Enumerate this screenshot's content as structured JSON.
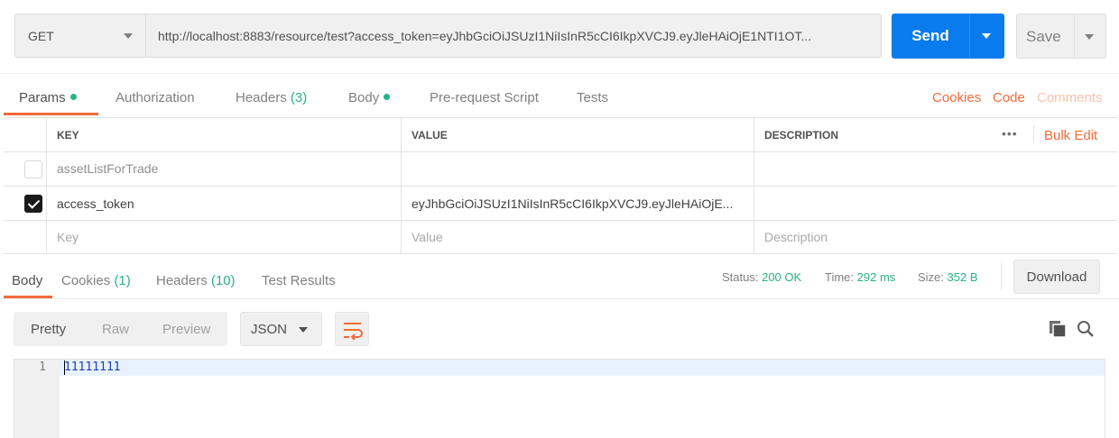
{
  "request": {
    "method": "GET",
    "url": "http://localhost:8883/resource/test?access_token=eyJhbGciOiJSUzI1NiIsInR5cCI6IkpXVCJ9.eyJleHAiOjE1NTI1OT...",
    "send_label": "Send",
    "save_label": "Save"
  },
  "request_tabs": {
    "params": "Params",
    "authorization": "Authorization",
    "headers": "Headers",
    "headers_count": "(3)",
    "body": "Body",
    "prerequest": "Pre-request Script",
    "tests": "Tests",
    "cookies_link": "Cookies",
    "code_link": "Code",
    "comments_link": "Comments"
  },
  "params_table": {
    "col_key": "KEY",
    "col_value": "VALUE",
    "col_description": "DESCRIPTION",
    "more": "•••",
    "bulk_edit": "Bulk Edit",
    "rows": [
      {
        "checked": false,
        "key": "assetListForTrade",
        "value": "",
        "description": ""
      },
      {
        "checked": true,
        "key": "access_token",
        "value": "eyJhbGciOiJSUzI1NiIsInR5cCI6IkpXVCJ9.eyJleHAiOjE...",
        "description": ""
      }
    ],
    "placeholder": {
      "key": "Key",
      "value": "Value",
      "description": "Description"
    }
  },
  "response_tabs": {
    "body": "Body",
    "cookies": "Cookies",
    "cookies_count": "(1)",
    "headers": "Headers",
    "headers_count": "(10)",
    "test_results": "Test Results"
  },
  "response_meta": {
    "status_label": "Status:",
    "status_value": "200 OK",
    "time_label": "Time:",
    "time_value": "292 ms",
    "size_label": "Size:",
    "size_value": "352 B",
    "download": "Download"
  },
  "view": {
    "pretty": "Pretty",
    "raw": "Raw",
    "preview": "Preview",
    "format": "JSON"
  },
  "response_body": {
    "line_number": "1",
    "content": "11111111"
  },
  "icons": [
    "chevron-down-icon",
    "wrap-icon",
    "copy-icon",
    "search-icon",
    "checkmark-icon"
  ],
  "colors": {
    "accent": "#f26b3a",
    "primary": "#097bed",
    "success": "#26b47f"
  }
}
